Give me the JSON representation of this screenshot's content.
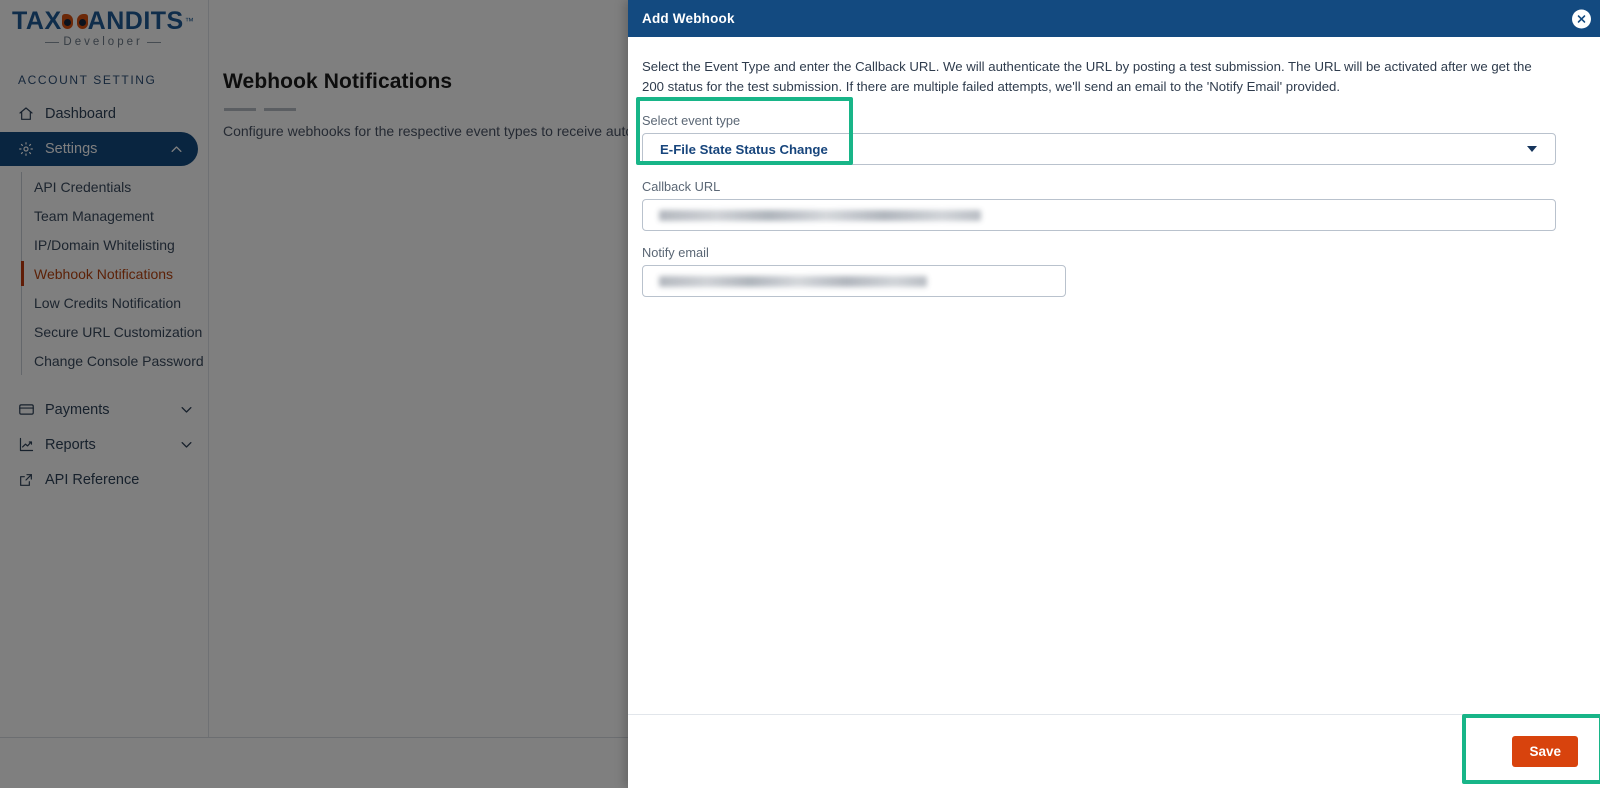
{
  "brand": {
    "name_part1": "TAX",
    "name_part2": "ANDITS",
    "trademark": "™",
    "tagline": "Developer",
    "owl_icon": "owl-mask-icon"
  },
  "sidebar": {
    "section_title": "ACCOUNT SETTING",
    "items": [
      {
        "label": "Dashboard",
        "icon": "home-icon",
        "active": false,
        "chevron": ""
      },
      {
        "label": "Settings",
        "icon": "gear-icon",
        "active": true,
        "chevron": "chevron-up-icon"
      },
      {
        "label": "Payments",
        "icon": "credit-card-icon",
        "active": false,
        "chevron": "chevron-down-icon"
      },
      {
        "label": "Reports",
        "icon": "chart-line-icon",
        "active": false,
        "chevron": "chevron-down-icon"
      },
      {
        "label": "API Reference",
        "icon": "external-link-icon",
        "active": false,
        "chevron": ""
      }
    ],
    "settings_subitems": [
      {
        "label": "API Credentials",
        "current": false
      },
      {
        "label": "Team Management",
        "current": false
      },
      {
        "label": "IP/Domain Whitelisting",
        "current": false
      },
      {
        "label": "Webhook Notifications",
        "current": true
      },
      {
        "label": "Low Credits Notification",
        "current": false
      },
      {
        "label": "Secure URL Customization",
        "current": false
      },
      {
        "label": "Change Console Password",
        "current": false
      }
    ]
  },
  "main": {
    "page_title": "Webhook Notifications",
    "page_subtitle": "Configure webhooks for the respective event types to receive automated notifications."
  },
  "footer": {
    "copyright": "©"
  },
  "modal": {
    "title": "Add Webhook",
    "close_icon": "close-circle-icon",
    "description": "Select the Event Type and enter the Callback URL. We will authenticate the URL by posting a test submission. The URL will be activated after we get the 200 status for the test submission. If there are multiple failed attempts, we'll send an email to the 'Notify Email' provided.",
    "event_type": {
      "label": "Select event type",
      "value": "E-File State Status Change",
      "caret_icon": "chevron-down-icon"
    },
    "callback_url": {
      "label": "Callback URL",
      "value": "",
      "redacted": true
    },
    "notify_email": {
      "label": "Notify email",
      "value": "",
      "redacted": true
    },
    "save_label": "Save"
  },
  "annotations": {
    "highlight_color": "#18b588",
    "boxes": [
      {
        "name": "event-type-highlight"
      },
      {
        "name": "save-button-highlight"
      }
    ]
  },
  "colors": {
    "brand_blue": "#1e5b96",
    "nav_active": "#134a80",
    "accent_orange": "#d8430d",
    "current_item": "#b8430f",
    "highlight_green": "#18b588"
  }
}
